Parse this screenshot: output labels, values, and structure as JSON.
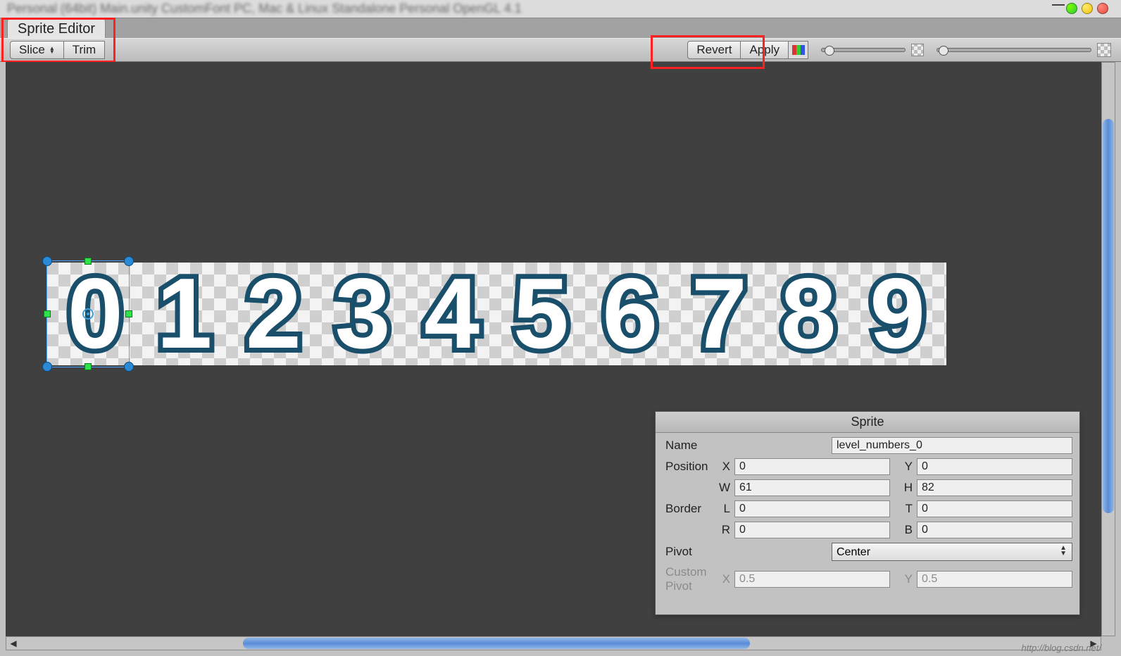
{
  "window": {
    "title_blur": "Personal (64bit)  Main.unity  CustomFont  PC, Mac & Linux Standalone  Personal  OpenGL 4.1"
  },
  "tab": {
    "label": "Sprite Editor"
  },
  "toolbar": {
    "slice": "Slice",
    "trim": "Trim",
    "revert": "Revert",
    "apply": "Apply"
  },
  "sprites": {
    "digits": [
      "0",
      "1",
      "2",
      "3",
      "4",
      "5",
      "6",
      "7",
      "8",
      "9"
    ]
  },
  "panel": {
    "title": "Sprite",
    "name_label": "Name",
    "name_value": "level_numbers_0",
    "position_label": "Position",
    "pos_x_lab": "X",
    "pos_x": "0",
    "pos_y_lab": "Y",
    "pos_y": "0",
    "pos_w_lab": "W",
    "pos_w": "61",
    "pos_h_lab": "H",
    "pos_h": "82",
    "border_label": "Border",
    "bor_l_lab": "L",
    "bor_l": "0",
    "bor_t_lab": "T",
    "bor_t": "0",
    "bor_r_lab": "R",
    "bor_r": "0",
    "bor_b_lab": "B",
    "bor_b": "0",
    "pivot_label": "Pivot",
    "pivot_value": "Center",
    "cpivot_label": "Custom Pivot",
    "cpivot_x_lab": "X",
    "cpivot_x": "0.5",
    "cpivot_y_lab": "Y",
    "cpivot_y": "0.5"
  },
  "watermark": "http://blog.csdn.net/"
}
